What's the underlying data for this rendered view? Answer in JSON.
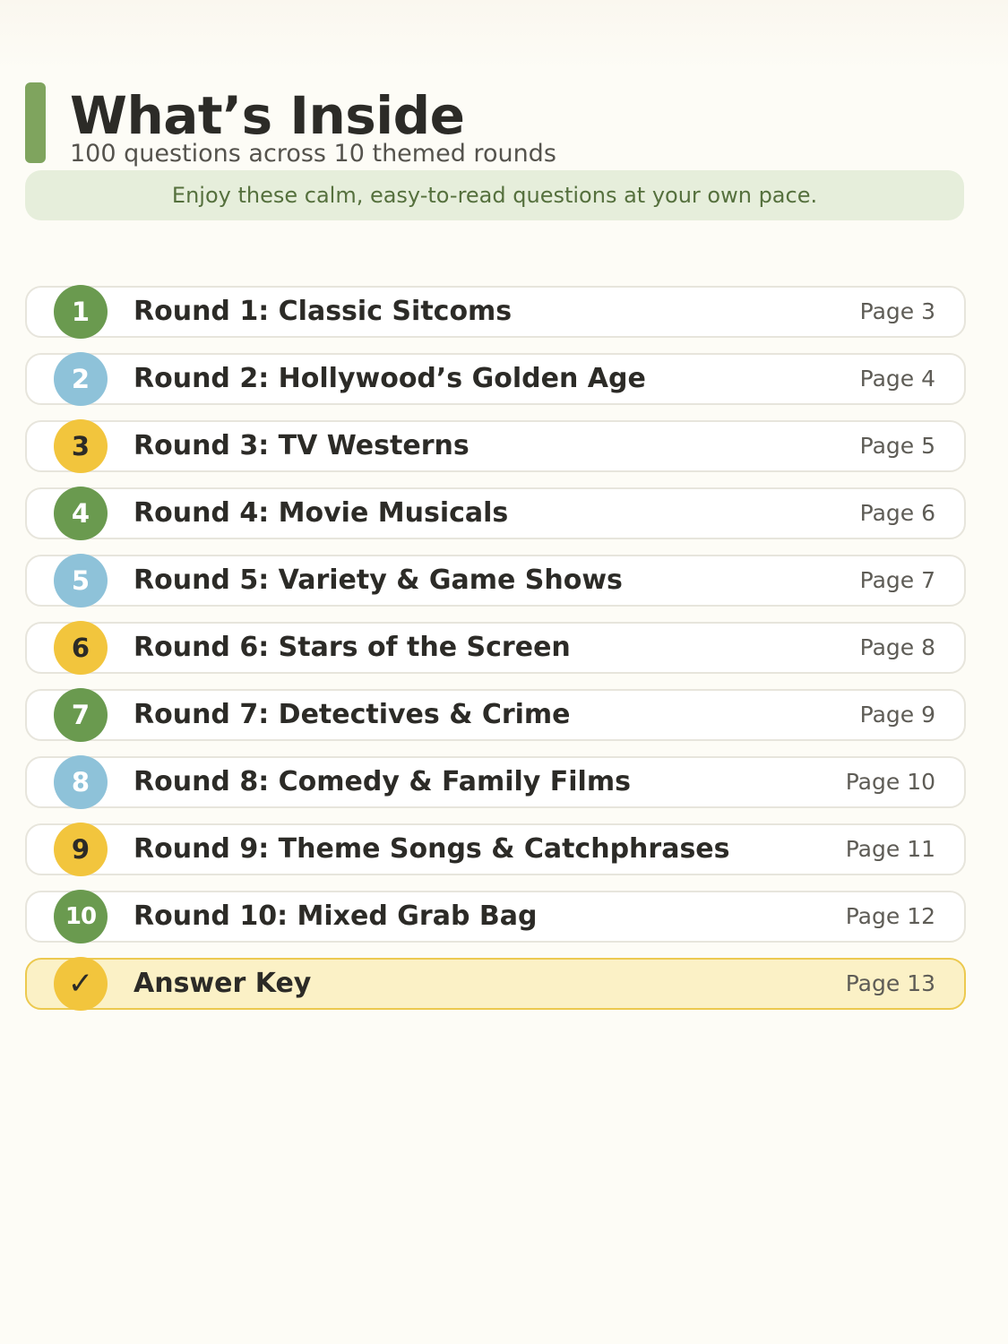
{
  "header": {
    "title": "What’s Inside",
    "subtitle": "100 questions across 10 themed rounds",
    "banner": "Enjoy these calm, easy-to-read questions at your own pace."
  },
  "colors": {
    "green": "#6a9a4f",
    "blue": "#8ec2d9",
    "yellow": "#f2c53d"
  },
  "rounds": [
    {
      "badge": "1",
      "title": "Round 1: Classic Sitcoms",
      "page": "Page 3",
      "color": "#6a9a4f"
    },
    {
      "badge": "2",
      "title": "Round 2: Hollywood’s Golden Age",
      "page": "Page 4",
      "color": "#8ec2d9"
    },
    {
      "badge": "3",
      "title": "Round 3: TV Westerns",
      "page": "Page 5",
      "color": "#f2c53d"
    },
    {
      "badge": "4",
      "title": "Round 4: Movie Musicals",
      "page": "Page 6",
      "color": "#6a9a4f"
    },
    {
      "badge": "5",
      "title": "Round 5: Variety & Game Shows",
      "page": "Page 7",
      "color": "#8ec2d9"
    },
    {
      "badge": "6",
      "title": "Round 6: Stars of the Screen",
      "page": "Page 8",
      "color": "#f2c53d"
    },
    {
      "badge": "7",
      "title": "Round 7: Detectives & Crime",
      "page": "Page 9",
      "color": "#6a9a4f"
    },
    {
      "badge": "8",
      "title": "Round 8: Comedy & Family Films",
      "page": "Page 10",
      "color": "#8ec2d9"
    },
    {
      "badge": "9",
      "title": "Round 9: Theme Songs & Catchphrases",
      "page": "Page 11",
      "color": "#f2c53d"
    },
    {
      "badge": "10",
      "title": "Round 10: Mixed Grab Bag",
      "page": "Page 12",
      "color": "#6a9a4f"
    }
  ],
  "answer_key": {
    "icon": "check-icon",
    "title": "Answer Key",
    "page": "Page 13",
    "color": "#f2c53d"
  }
}
